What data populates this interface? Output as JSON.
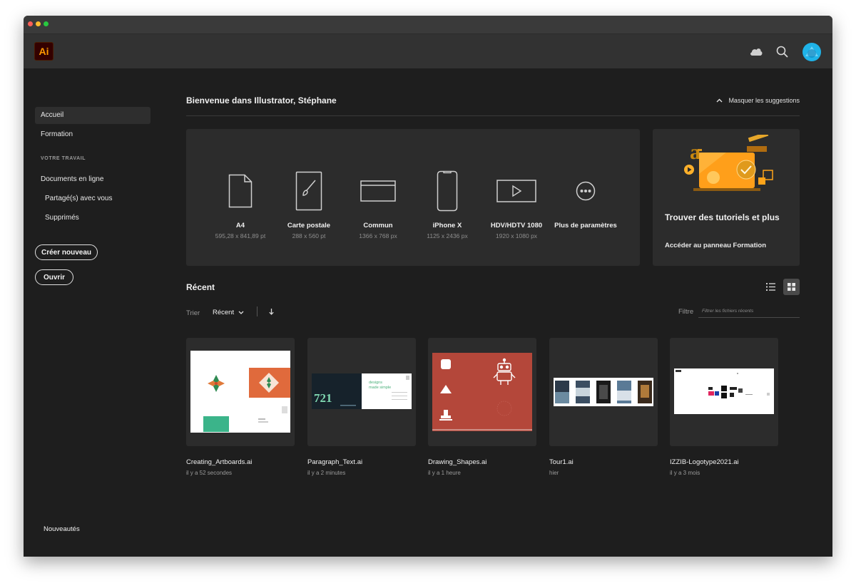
{
  "app": {
    "logo_text": "Ai"
  },
  "sidebar": {
    "items": [
      {
        "label": "Accueil"
      },
      {
        "label": "Formation"
      }
    ],
    "section_heading": "VOTRE TRAVAIL",
    "work_items": [
      {
        "label": "Documents en ligne"
      },
      {
        "label": "Partagé(s) avec vous"
      },
      {
        "label": "Supprimés"
      }
    ],
    "create_label": "Créer nouveau",
    "open_label": "Ouvrir",
    "news_label": "Nouveautés"
  },
  "main": {
    "welcome": "Bienvenue dans Illustrator, Stéphane",
    "hide_suggestions": "Masquer les suggestions",
    "presets": [
      {
        "name": "A4",
        "size": "595,28 x 841,89 pt",
        "icon": "document-icon"
      },
      {
        "name": "Carte postale",
        "size": "288 x 560 pt",
        "icon": "brush-icon"
      },
      {
        "name": "Commun",
        "size": "1366 x 768 px",
        "icon": "browser-icon"
      },
      {
        "name": "iPhone X",
        "size": "1125 x 2436 px",
        "icon": "phone-icon"
      },
      {
        "name": "HDV/HDTV 1080",
        "size": "1920 x 1080 px",
        "icon": "video-icon"
      },
      {
        "name": "Plus de paramètres",
        "size": "",
        "icon": "more-icon"
      }
    ],
    "tutorial": {
      "title": "Trouver des tutoriels et plus",
      "link": "Accéder au panneau Formation"
    },
    "recent": {
      "title": "Récent",
      "sort_label": "Trier",
      "sort_value": "Récent",
      "filter_label": "Filtre",
      "filter_placeholder": "Filtrer les fichiers récents"
    },
    "files": [
      {
        "name": "Creating_Artboards.ai",
        "time": "il y a 52 secondes"
      },
      {
        "name": "Paragraph_Text.ai",
        "time": "il y a 2 minutes"
      },
      {
        "name": "Drawing_Shapes.ai",
        "time": "il y a 1 heure"
      },
      {
        "name": "Tour1.ai",
        "time": "hier"
      },
      {
        "name": "IZZIB-Logotype2021.ai",
        "time": "il y a 3 mois"
      }
    ]
  },
  "thumbnails": {
    "paragraph_number": "721",
    "paragraph_tagline": "designs made simple"
  },
  "colors": {
    "accent_orange": "#ff9a00",
    "avatar": "#1fb3e8",
    "shapes_bg": "#b4473a"
  }
}
